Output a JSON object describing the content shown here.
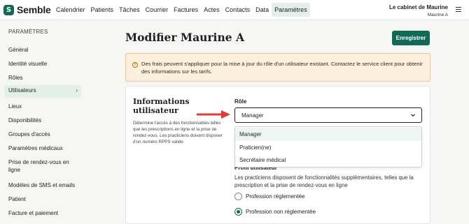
{
  "app": {
    "logo_mark": "S",
    "logo_text": "Semble"
  },
  "nav": {
    "items": [
      {
        "label": "Calendrier",
        "active": false
      },
      {
        "label": "Patients",
        "active": false
      },
      {
        "label": "Tâches",
        "active": false
      },
      {
        "label": "Courrier",
        "active": false
      },
      {
        "label": "Factures",
        "active": false
      },
      {
        "label": "Actes",
        "active": false
      },
      {
        "label": "Contacts",
        "active": false
      },
      {
        "label": "Data",
        "active": false
      },
      {
        "label": "Paramètres",
        "active": true
      }
    ]
  },
  "account": {
    "name": "Le cabinet de Maurine",
    "user": "Maurine A"
  },
  "sidebar": {
    "heading": "PARAMÈTRES",
    "items": [
      {
        "label": "Général"
      },
      {
        "label": "Identité visuelle"
      },
      {
        "label": "Rôles"
      },
      {
        "label": "Utilisateurs",
        "active": true
      },
      {
        "label": "Lieux"
      },
      {
        "label": "Disponibilités"
      },
      {
        "label": "Groupes d'accès"
      },
      {
        "label": "Paramètres médicaux"
      },
      {
        "label": "Prise de rendez-vous en ligne"
      },
      {
        "label": "Modèles de SMS et emails"
      },
      {
        "label": "Patient"
      },
      {
        "label": "Facture et paiement"
      }
    ]
  },
  "page": {
    "title": "Modifier Maurine A",
    "save_label": "Enregistrer"
  },
  "alert": {
    "text": "Des frais peuvent s'appliquer pour la mise à jour du rôle d'un utilisateur existant. Contactez le service client pour obtenir des informations sur les tarifs."
  },
  "user_info": {
    "title": "Informations utilisateur",
    "description": "Détermine l'accès à des fonctionnalités telles que les prescriptions en ligne et la prise de rendez-vous. Les practiciens doivent disposer d'un numéro RPPS valide"
  },
  "role": {
    "label": "Rôle",
    "selected": "Manager",
    "options": [
      "Manager",
      "Praticien(ne)",
      "Secrétaire médical"
    ]
  },
  "profile": {
    "label": "Profil utilisateur",
    "description": "Les practiciens disposent de fonctionnalités supplémentaires, telles que la prescription et la prise de rendez-vous en ligne",
    "options": [
      {
        "label": "Profession réglementée",
        "checked": false
      },
      {
        "label": "Profession non réglementée",
        "checked": true
      }
    ]
  },
  "colors": {
    "brand": "#0f6b55",
    "active_bg": "#e3efe9",
    "alert_bg": "#fcefdd",
    "arrow": "#e53b2c"
  }
}
